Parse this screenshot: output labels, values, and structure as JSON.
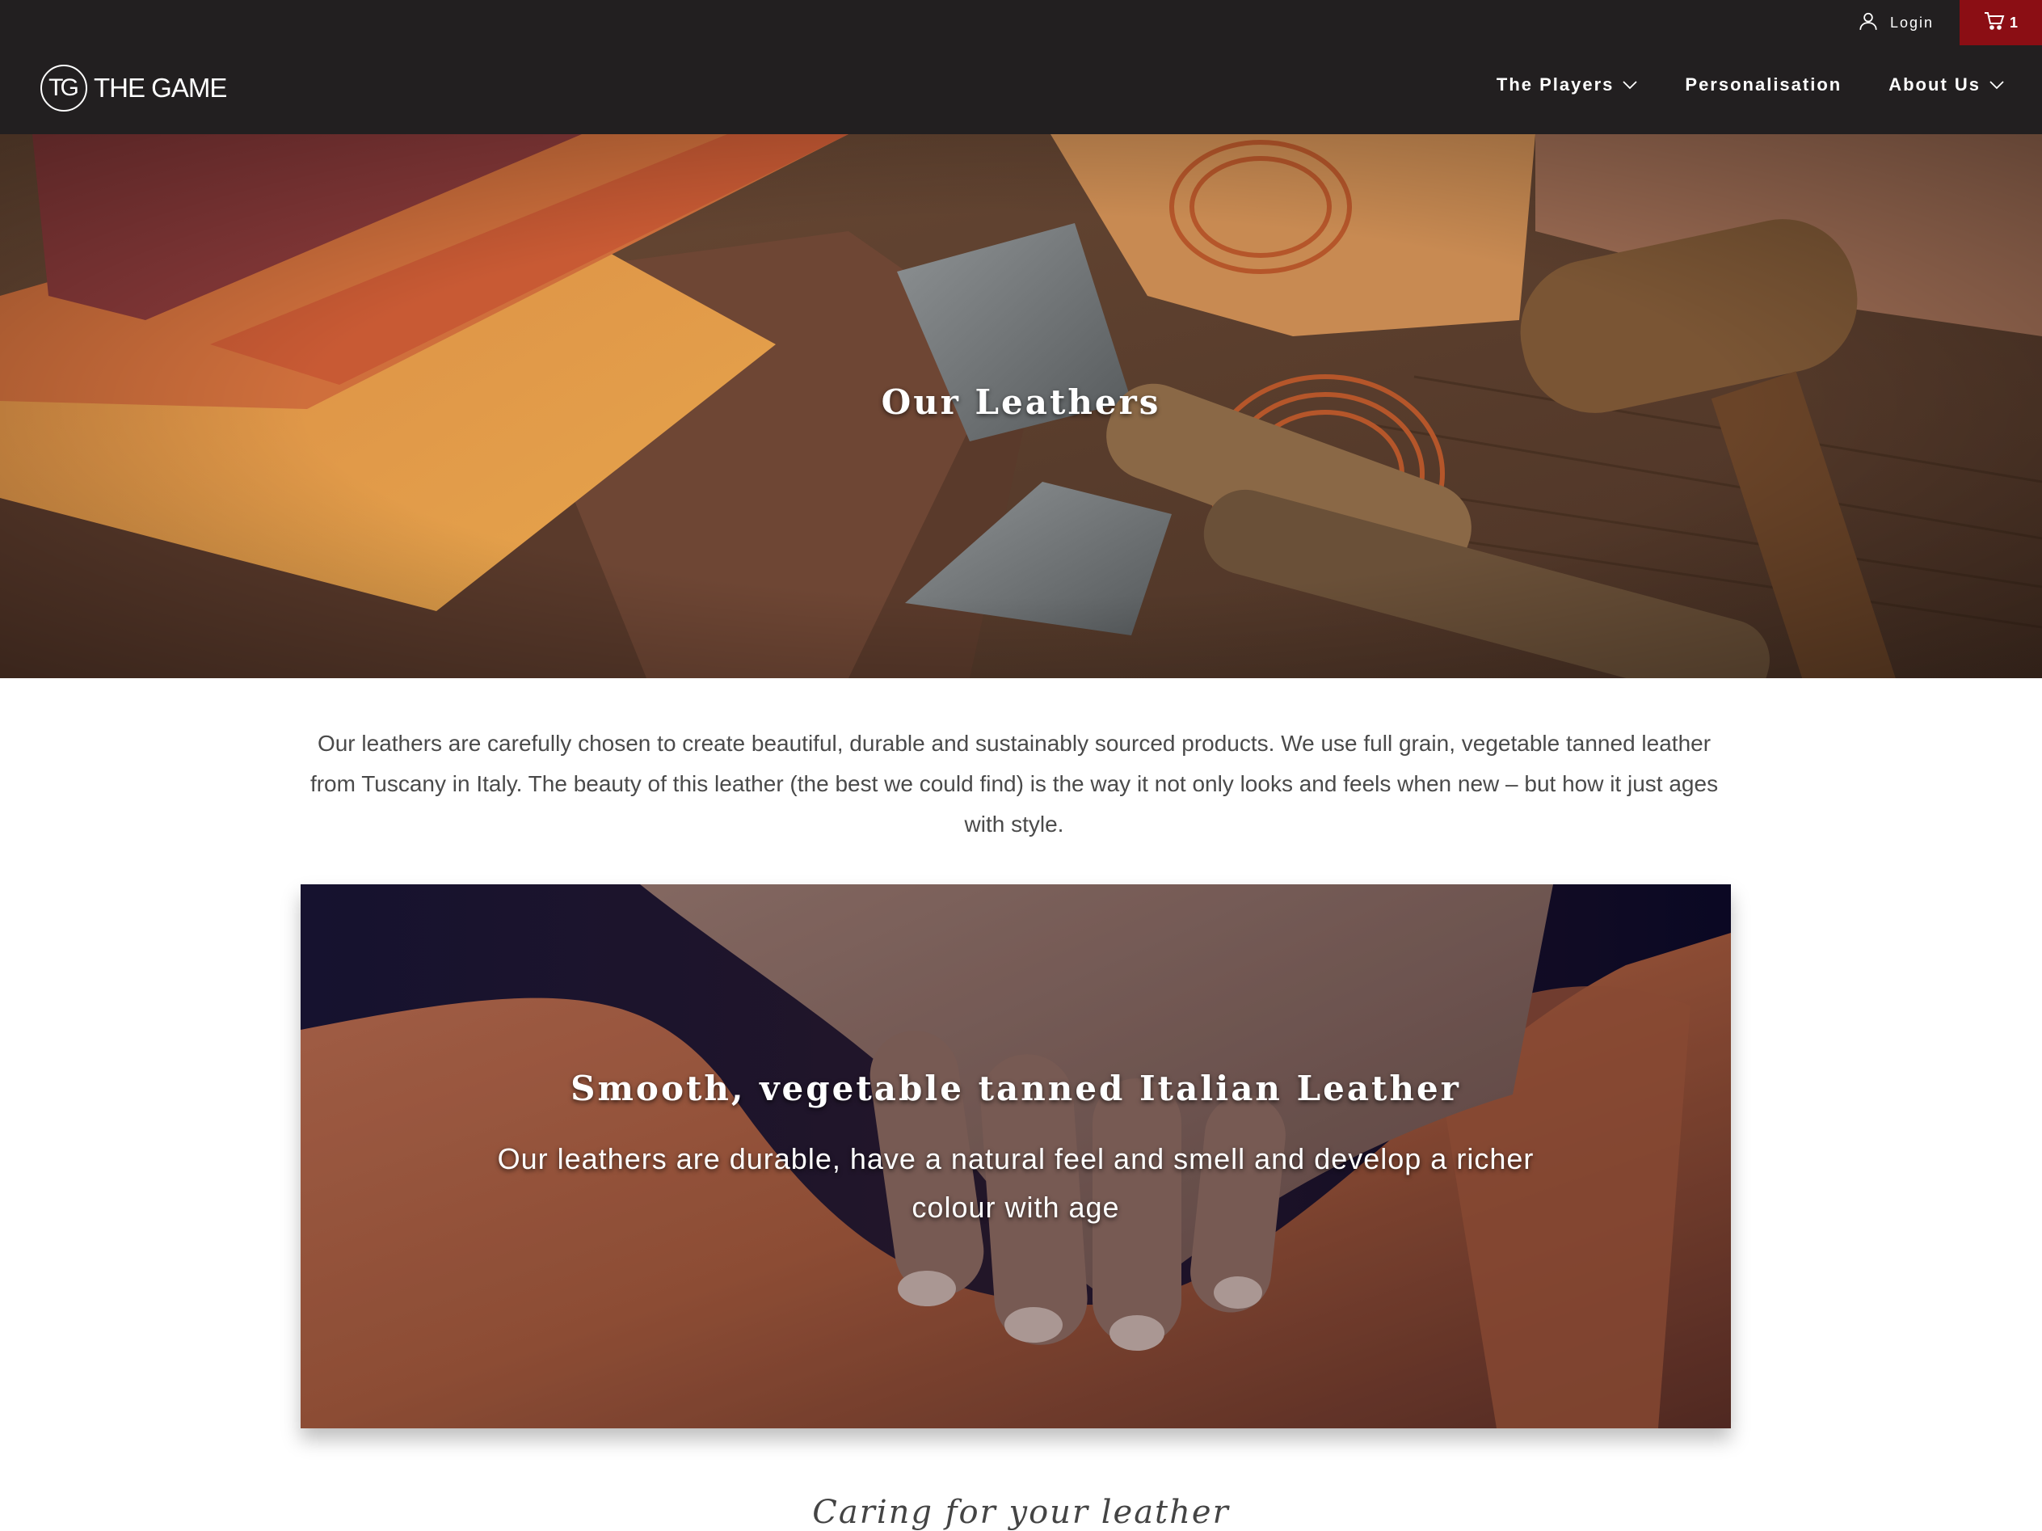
{
  "header": {
    "login_label": "Login",
    "cart_count": "1",
    "logo_mark": "TG",
    "logo_text": "THE GAME",
    "nav": [
      {
        "label": "The Players",
        "has_dropdown": true
      },
      {
        "label": "Personalisation",
        "has_dropdown": false
      },
      {
        "label": "About Us",
        "has_dropdown": true
      }
    ],
    "colors": {
      "background": "#221f20",
      "cart_background": "#8b0e14",
      "text": "#ffffff"
    }
  },
  "hero": {
    "title": "Our Leathers",
    "image_subject": "leather hides with leatherworking knives, cord and mallet"
  },
  "intro": {
    "text": "Our leathers are carefully chosen to create beautiful, durable and sustainably sourced products. We use full grain, vegetable tanned leather from Tuscany in Italy. The beauty of this leather (the best we could find) is the way it not only looks and feels when new – but how it just ages with style."
  },
  "feature": {
    "title": "Smooth, vegetable tanned Italian Leather",
    "subtitle": "Our leathers are durable, have a natural feel and smell and develop a richer colour with age",
    "image_subject": "hands smoothing tan leather"
  },
  "next_section": {
    "heading": "Caring for your leather"
  },
  "icons": {
    "login": "user-icon",
    "cart": "cart-icon",
    "dropdown": "chevron-down-icon"
  }
}
